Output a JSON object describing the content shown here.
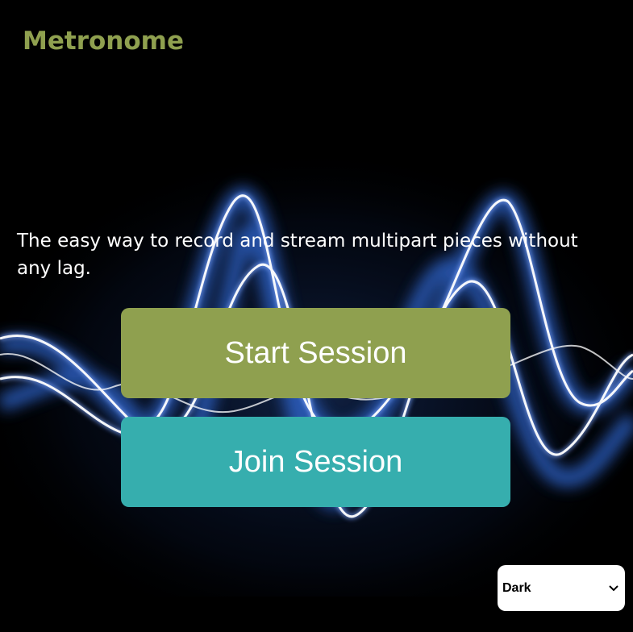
{
  "header": {
    "title": "Metronome"
  },
  "hero": {
    "tagline": "The easy way to record and stream multipart pieces without any lag."
  },
  "actions": {
    "start_label": "Start Session",
    "join_label": "Join Session"
  },
  "theme": {
    "selected": "Dark"
  },
  "colors": {
    "accent_green": "#8fa04f",
    "accent_teal": "#36aeae",
    "background": "#000000"
  }
}
